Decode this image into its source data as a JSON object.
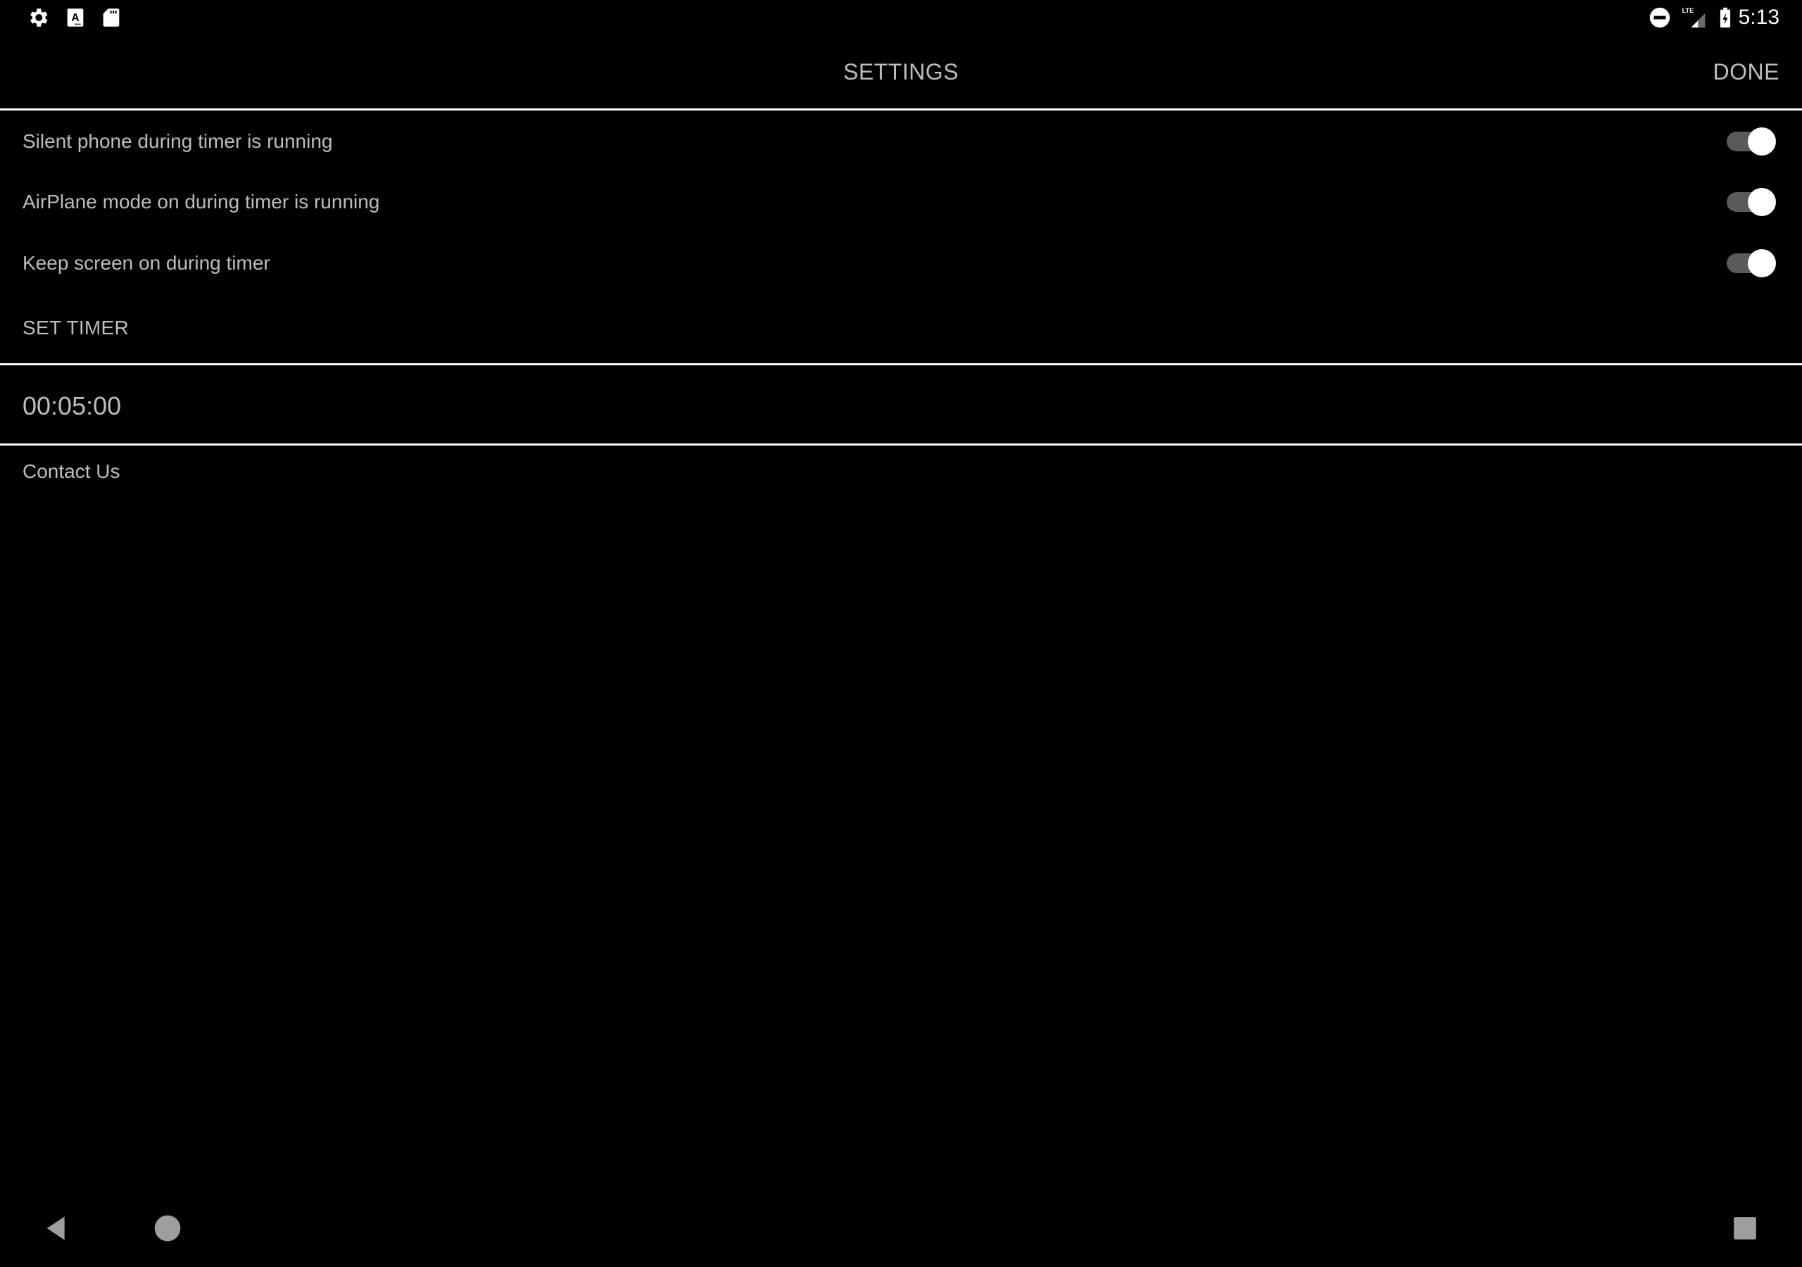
{
  "status_bar": {
    "left_icons": [
      "gear-icon",
      "font-a-icon",
      "sd-card-icon"
    ],
    "right_icons": [
      "do-not-disturb-icon",
      "lte-signal-icon",
      "battery-charging-icon"
    ],
    "network_label": "LTE",
    "time": "5:13"
  },
  "header": {
    "title": "SETTINGS",
    "done_label": "DONE"
  },
  "settings": [
    {
      "label": "Silent phone during timer is running",
      "enabled": true
    },
    {
      "label": "AirPlane mode on during timer is running",
      "enabled": true
    },
    {
      "label": "Keep screen on during timer",
      "enabled": true
    }
  ],
  "timer": {
    "section_label": "SET TIMER",
    "value": "00:05:00"
  },
  "contact": {
    "label": "Contact Us"
  },
  "nav_bar": {
    "buttons": [
      "back-icon",
      "home-icon",
      "recents-icon"
    ]
  },
  "colors": {
    "background": "#000000",
    "text": "#bdbdbd",
    "divider": "#ffffff",
    "toggle_track": "#5a5a5a",
    "toggle_thumb": "#ffffff",
    "nav_icon": "#9e9e9e"
  }
}
